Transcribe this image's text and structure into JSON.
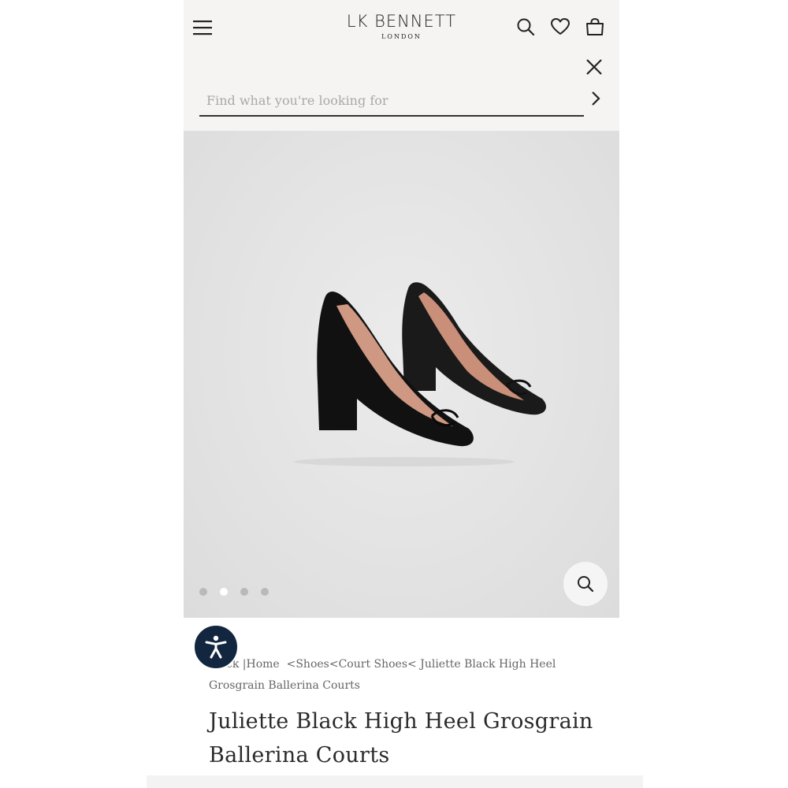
{
  "brand": {
    "name": "LK BENNETT",
    "location": "LONDON"
  },
  "search": {
    "placeholder": "Find what you're looking for",
    "value": ""
  },
  "gallery": {
    "dot_count": 4,
    "active_index": 1
  },
  "breadcrumb": {
    "back": "ck |",
    "items": [
      "Home",
      "Shoes",
      "Court Shoes",
      "Juliette Black High Heel Grosgrain Ballerina Courts"
    ]
  },
  "product": {
    "title": "Juliette Black High Heel Grosgrain Ballerina Courts"
  },
  "icons": {
    "menu": "hamburger-menu-icon",
    "search": "search-icon",
    "wishlist": "heart-icon",
    "bag": "shopping-bag-icon",
    "close": "close-icon",
    "go": "chevron-right-icon",
    "zoom": "zoom-icon",
    "accessibility": "accessibility-icon"
  },
  "colors": {
    "header_bg": "#f5f4f2",
    "gallery_bg": "#e4e4e4",
    "accessibility_bg": "#13263f",
    "text": "#2b2b2b"
  }
}
